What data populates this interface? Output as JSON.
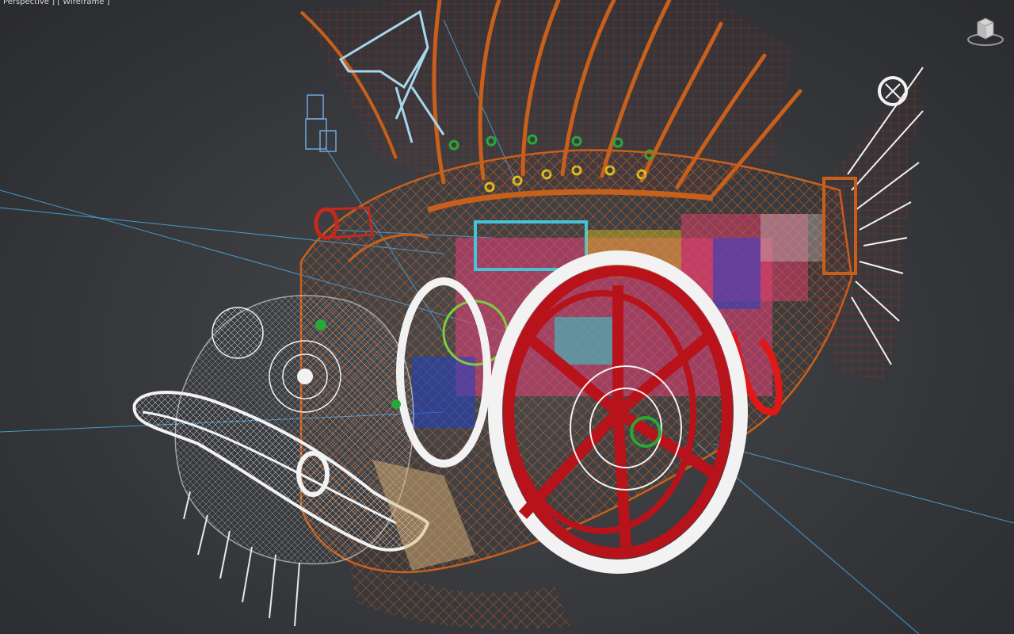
{
  "viewport": {
    "label": "Perspective ] [ Wireframe ]",
    "background_top": "#3a3c40",
    "background_edge": "#2a2b2e"
  },
  "viewcube": {
    "icon": "viewcube-icon"
  },
  "colors": {
    "fin_orange": "#c8601c",
    "fin_red": "#d8261c",
    "head_white": "#f2f2f2",
    "wheel_red": "#b8121a",
    "guide_blue": "#4aa3df",
    "rig_blue": "#6fa7e0",
    "green_ring": "#29a83a",
    "yellow_ring": "#d8c21e"
  }
}
